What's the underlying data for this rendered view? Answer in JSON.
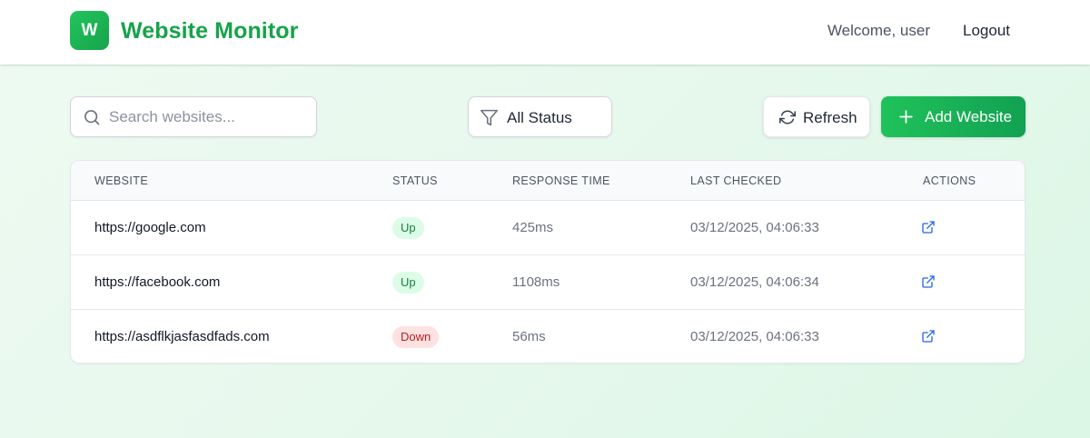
{
  "header": {
    "logo_letter": "W",
    "brand": "Website Monitor",
    "welcome": "Welcome, user",
    "logout": "Logout"
  },
  "toolbar": {
    "search_placeholder": "Search websites...",
    "search_value": "",
    "status_filter": "All Status",
    "refresh": "Refresh",
    "add_website": "Add Website"
  },
  "table": {
    "columns": [
      "WEBSITE",
      "STATUS",
      "RESPONSE TIME",
      "LAST CHECKED",
      "ACTIONS"
    ],
    "rows": [
      {
        "website": "https://google.com",
        "status": "Up",
        "response_time": "425ms",
        "last_checked": "03/12/2025, 04:06:33"
      },
      {
        "website": "https://facebook.com",
        "status": "Up",
        "response_time": "1108ms",
        "last_checked": "03/12/2025, 04:06:34"
      },
      {
        "website": "https://asdflkjasfasdfads.com",
        "status": "Down",
        "response_time": "56ms",
        "last_checked": "03/12/2025, 04:06:33"
      }
    ]
  },
  "icons": {
    "search": "search-icon",
    "filter": "filter-icon",
    "refresh": "refresh-icon",
    "add": "plus-icon",
    "action": "external-link-icon"
  },
  "colors": {
    "brand": "#16a34a",
    "accent_start": "#1fc25a",
    "accent_end": "#12a152",
    "status_up_bg": "#dcfce7",
    "status_up_text": "#15803d",
    "status_down_bg": "#fee2e2",
    "status_down_text": "#b91c1c",
    "link_icon": "#2563eb"
  }
}
